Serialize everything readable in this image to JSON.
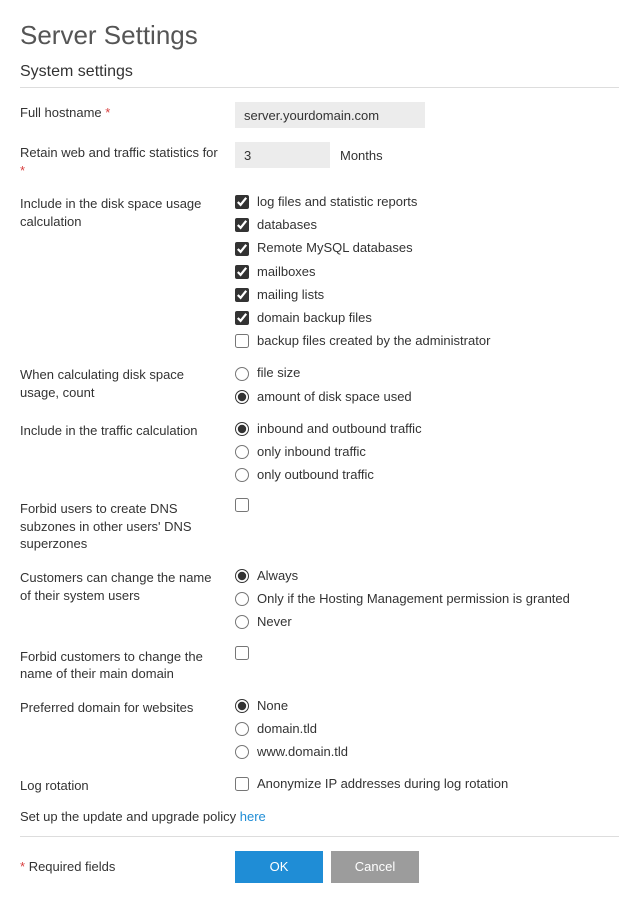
{
  "page": {
    "title": "Server Settings",
    "sectionTitle": "System settings",
    "requiredNote": "Required fields",
    "policyPrefix": "Set up the update and upgrade policy ",
    "policyLink": "here"
  },
  "fields": {
    "hostname": {
      "label": "Full hostname",
      "value": "server.yourdomain.com"
    },
    "retain": {
      "label": "Retain web and traffic statistics for",
      "value": "3",
      "unit": "Months"
    },
    "diskUsage": {
      "label": "Include in the disk space usage calculation",
      "options": [
        {
          "label": "log files and statistic reports",
          "checked": true
        },
        {
          "label": "databases",
          "checked": true
        },
        {
          "label": "Remote MySQL databases",
          "checked": true
        },
        {
          "label": "mailboxes",
          "checked": true
        },
        {
          "label": "mailing lists",
          "checked": true
        },
        {
          "label": "domain backup files",
          "checked": true
        },
        {
          "label": "backup files created by the administrator",
          "checked": false
        }
      ]
    },
    "diskCount": {
      "label": "When calculating disk space usage, count",
      "options": [
        {
          "label": "file size",
          "selected": false
        },
        {
          "label": "amount of disk space used",
          "selected": true
        }
      ]
    },
    "trafficCalc": {
      "label": "Include in the traffic calculation",
      "options": [
        {
          "label": "inbound and outbound traffic",
          "selected": true
        },
        {
          "label": "only inbound traffic",
          "selected": false
        },
        {
          "label": "only outbound traffic",
          "selected": false
        }
      ]
    },
    "forbidDns": {
      "label": "Forbid users to create DNS subzones in other users' DNS superzones",
      "checked": false
    },
    "customersSysUsers": {
      "label": "Customers can change the name of their system users",
      "options": [
        {
          "label": "Always",
          "selected": true
        },
        {
          "label": "Only if the Hosting Management permission is granted",
          "selected": false
        },
        {
          "label": "Never",
          "selected": false
        }
      ]
    },
    "forbidMainDomain": {
      "label": "Forbid customers to change the name of their main domain",
      "checked": false
    },
    "preferredDomain": {
      "label": "Preferred domain for websites",
      "options": [
        {
          "label": "None",
          "selected": true
        },
        {
          "label": "domain.tld",
          "selected": false
        },
        {
          "label": "www.domain.tld",
          "selected": false
        }
      ]
    },
    "logRotation": {
      "label": "Log rotation",
      "optionLabel": "Anonymize IP addresses during log rotation",
      "checked": false
    }
  },
  "buttons": {
    "ok": "OK",
    "cancel": "Cancel"
  }
}
